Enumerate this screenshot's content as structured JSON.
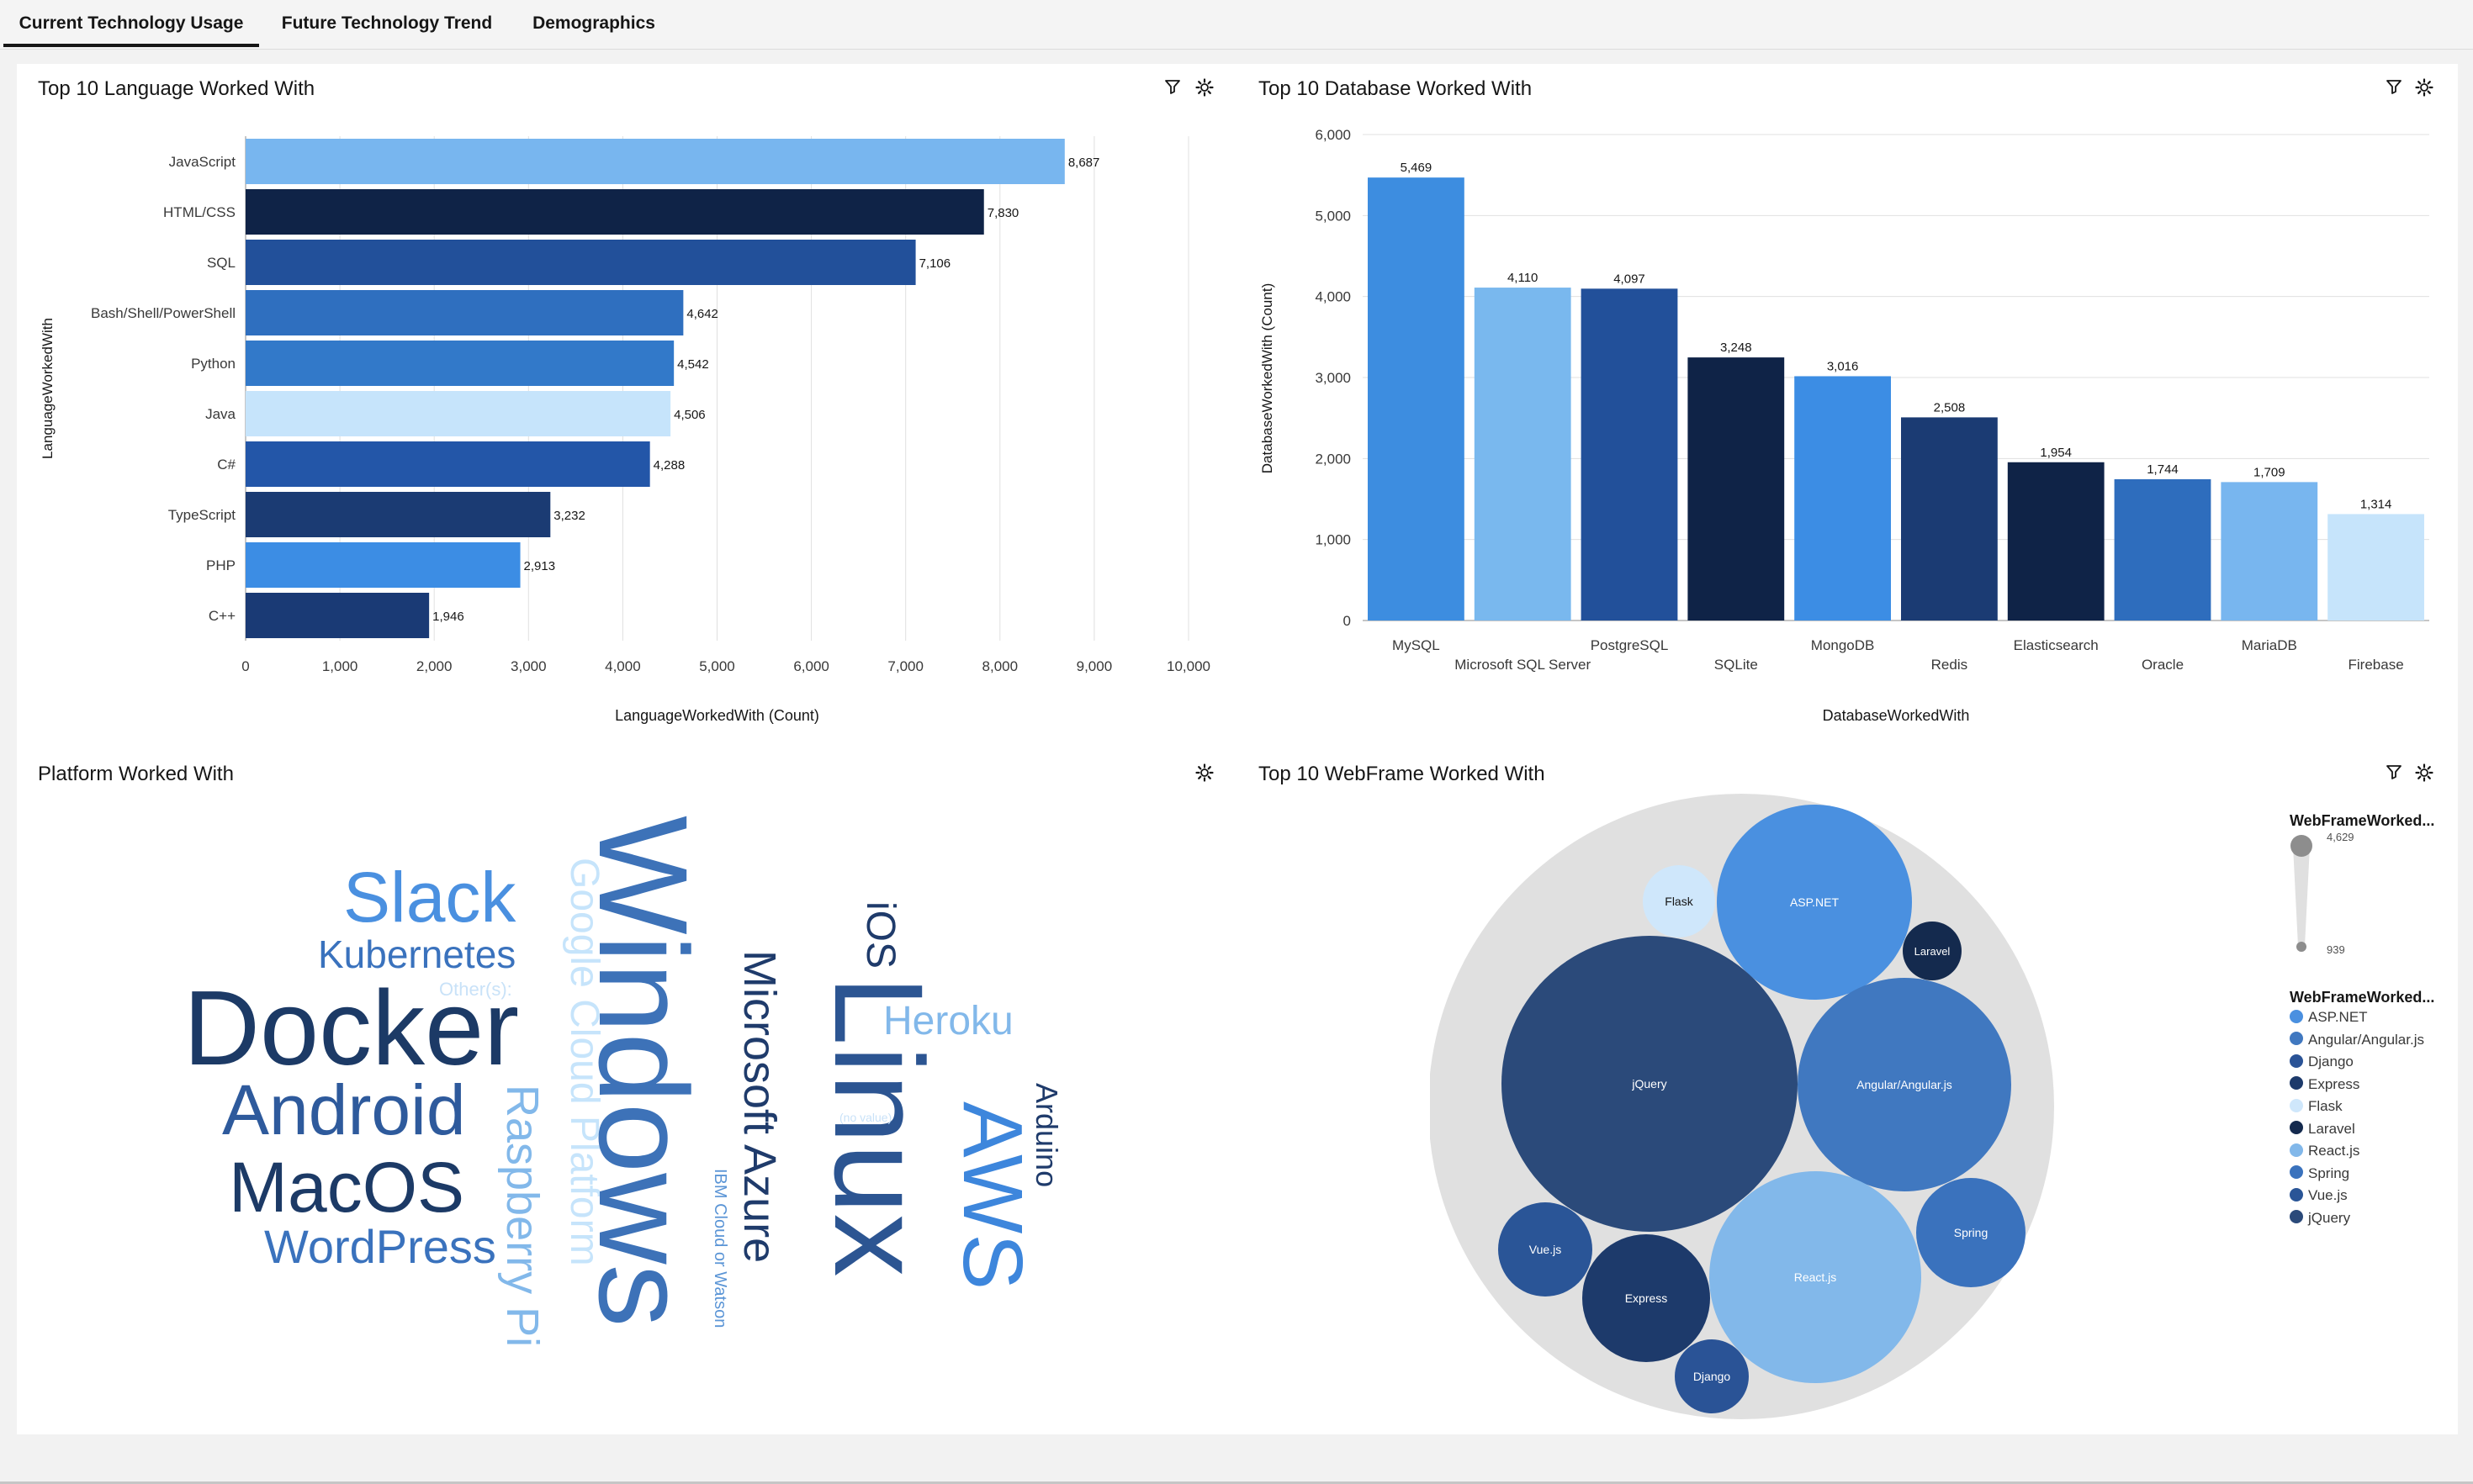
{
  "tabs": [
    {
      "label": "Current Technology Usage",
      "active": true
    },
    {
      "label": "Future Technology Trend",
      "active": false
    },
    {
      "label": "Demographics",
      "active": false
    }
  ],
  "widgets": {
    "language": {
      "title": "Top 10 Language Worked With",
      "icons": [
        "filter-icon",
        "gear-icon"
      ]
    },
    "database": {
      "title": "Top 10 Database Worked With",
      "icons": [
        "filter-icon",
        "gear-icon"
      ]
    },
    "platform": {
      "title": "Platform Worked With",
      "icons": [
        "gear-icon"
      ]
    },
    "webframe": {
      "title": "Top 10 WebFrame Worked With",
      "icons": [
        "filter-icon",
        "gear-icon"
      ]
    }
  },
  "chart_data": [
    {
      "id": "language",
      "type": "bar",
      "orientation": "horizontal",
      "categories": [
        "JavaScript",
        "HTML/CSS",
        "SQL",
        "Bash/Shell/PowerShell",
        "Python",
        "Java",
        "C#",
        "TypeScript",
        "PHP",
        "C++"
      ],
      "values": [
        8687,
        7830,
        7106,
        4642,
        4542,
        4506,
        4288,
        3232,
        2913,
        1946
      ],
      "value_labels": [
        "8,687",
        "7,830",
        "7,106",
        "4,642",
        "4,542",
        "4,506",
        "4,288",
        "3,232",
        "2,913",
        "1,946"
      ],
      "colors": [
        "#78b6ef",
        "#0f2347",
        "#22509a",
        "#2f6fbf",
        "#3279c9",
        "#c6e4fb",
        "#2356a8",
        "#1b3b73",
        "#3c8de4",
        "#1a3a75"
      ],
      "xlabel": "LanguageWorkedWith (Count)",
      "ylabel": "LanguageWorkedWith",
      "xlim": [
        0,
        10000
      ],
      "xticks": [
        "0",
        "1,000",
        "2,000",
        "3,000",
        "4,000",
        "5,000",
        "6,000",
        "7,000",
        "8,000",
        "9,000",
        "10,000"
      ],
      "grid": true
    },
    {
      "id": "database",
      "type": "bar",
      "orientation": "vertical",
      "categories": [
        "MySQL",
        "Microsoft SQL Server",
        "PostgreSQL",
        "SQLite",
        "MongoDB",
        "Redis",
        "Elasticsearch",
        "Oracle",
        "MariaDB",
        "Firebase"
      ],
      "values": [
        5469,
        4110,
        4097,
        3248,
        3016,
        2508,
        1954,
        1744,
        1709,
        1314
      ],
      "value_labels": [
        "5,469",
        "4,110",
        "4,097",
        "3,248",
        "3,016",
        "2,508",
        "1,954",
        "1,744",
        "1,709",
        "1,314"
      ],
      "colors": [
        "#3d8de0",
        "#79b8ee",
        "#22509a",
        "#0f2347",
        "#3c8de4",
        "#1b3b73",
        "#0f2347",
        "#2e6dbd",
        "#78b6ef",
        "#c6e4fb"
      ],
      "xlabel": "DatabaseWorkedWith",
      "ylabel": "DatabaseWorkedWith (Count)",
      "ylim": [
        0,
        6000
      ],
      "yticks": [
        "0",
        "1,000",
        "2,000",
        "3,000",
        "4,000",
        "5,000",
        "6,000"
      ],
      "grid": true
    },
    {
      "id": "webframe",
      "type": "bubble",
      "series": [
        {
          "name": "ASP.NET",
          "color": "#4a90e0"
        },
        {
          "name": "Angular/Angular.js",
          "color": "#4078c0"
        },
        {
          "name": "Django",
          "color": "#2a5396"
        },
        {
          "name": "Express",
          "color": "#1d3a6b"
        },
        {
          "name": "Flask",
          "color": "#cfe7fb"
        },
        {
          "name": "Laravel",
          "color": "#142a4e"
        },
        {
          "name": "React.js",
          "color": "#82b8ea"
        },
        {
          "name": "Spring",
          "color": "#3a72bd"
        },
        {
          "name": "Vue.js",
          "color": "#2a5597"
        },
        {
          "name": "jQuery",
          "color": "#2b4a7a"
        }
      ],
      "size_legend": {
        "title": "WebFrameWorked...",
        "max_label": "4,629",
        "min_label": "939"
      },
      "color_legend": {
        "title": "WebFrameWorked..."
      }
    }
  ],
  "wordcloud": {
    "words": [
      {
        "text": "Docker",
        "color": "#1c3a66"
      },
      {
        "text": "Slack",
        "color": "#4a90e0"
      },
      {
        "text": "Kubernetes",
        "color": "#3a72bd"
      },
      {
        "text": "Other(s):",
        "color": "#c9e2f8"
      },
      {
        "text": "Android",
        "color": "#2e5a9c"
      },
      {
        "text": "MacOS",
        "color": "#1c3a66"
      },
      {
        "text": "WordPress",
        "color": "#3a72bd"
      },
      {
        "text": "Raspberry Pi",
        "color": "#82b8ea"
      },
      {
        "text": "Google Cloud Platform",
        "color": "#c6e4fb"
      },
      {
        "text": "Windows",
        "color": "#3d72b8"
      },
      {
        "text": "IBM Cloud or Watson",
        "color": "#5b95d6"
      },
      {
        "text": "Microsoft Azure",
        "color": "#1f3b6b"
      },
      {
        "text": "iOS",
        "color": "#1f3b6b"
      },
      {
        "text": "Linux",
        "color": "#2c5592"
      },
      {
        "text": "Heroku",
        "color": "#82b8ea"
      },
      {
        "text": "AWS",
        "color": "#3d86dc"
      },
      {
        "text": "Arduino",
        "color": "#1f3b6b"
      },
      {
        "text": "(no value)",
        "color": "#c9e2f8"
      }
    ]
  }
}
